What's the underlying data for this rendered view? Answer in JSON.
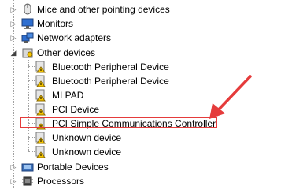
{
  "tree": {
    "items": [
      {
        "label": "Mice and other pointing devices",
        "icon": "mouse-icon",
        "level": 0,
        "toggle": "▷"
      },
      {
        "label": "Monitors",
        "icon": "monitor-icon",
        "level": 0,
        "toggle": "▷"
      },
      {
        "label": "Network adapters",
        "icon": "network-adapter-icon",
        "level": 0,
        "toggle": "▷"
      },
      {
        "label": "Other devices",
        "icon": "other-devices-icon",
        "level": 0,
        "toggle": "◢"
      },
      {
        "label": "Bluetooth Peripheral Device",
        "icon": "warning-device-icon",
        "level": 1
      },
      {
        "label": "Bluetooth Peripheral Device",
        "icon": "warning-device-icon",
        "level": 1
      },
      {
        "label": "MI PAD",
        "icon": "warning-device-icon",
        "level": 1
      },
      {
        "label": "PCI Device",
        "icon": "warning-device-icon",
        "level": 1
      },
      {
        "label": "PCI Simple Communications Controller",
        "icon": "warning-device-icon",
        "level": 1,
        "highlighted": true
      },
      {
        "label": "Unknown device",
        "icon": "warning-device-icon",
        "level": 1
      },
      {
        "label": "Unknown device",
        "icon": "warning-device-icon",
        "level": 1
      },
      {
        "label": "Portable Devices",
        "icon": "portable-devices-icon",
        "level": 0,
        "toggle": "▷"
      },
      {
        "label": "Processors",
        "icon": "processor-icon",
        "level": 0,
        "toggle": "▷"
      }
    ]
  },
  "colors": {
    "highlight": "#e53b3b",
    "warning": "#f5c400"
  }
}
